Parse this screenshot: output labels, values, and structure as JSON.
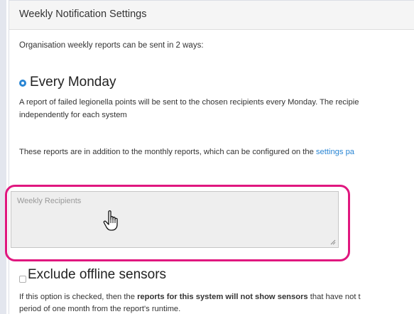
{
  "panel": {
    "title": "Weekly Notification Settings",
    "intro": "Organisation weekly reports can be sent in 2 ways:"
  },
  "monday_option": {
    "label": "Every Monday",
    "checked": true,
    "description_line1": "A report of failed legionella points will be sent to the chosen recipients every Monday. The recipie",
    "description_line2": "independently for each system"
  },
  "monthly_note": {
    "text": "These reports are in addition to the monthly reports, which can be configured on the ",
    "link_text": "settings pa"
  },
  "recipients_field": {
    "placeholder": "Weekly Recipients",
    "value": ""
  },
  "offline_option": {
    "label": "Exclude offline sensors",
    "checked": false,
    "desc_prefix": "If this option is checked, then the ",
    "desc_bold": "reports for this system will not show sensors",
    "desc_suffix": " that have not t",
    "desc_line2": "period of one month from the report's runtime."
  },
  "colors": {
    "accent": "#2a86d4",
    "highlight_border": "#e0177f",
    "header_bg": "#f5f5f5",
    "field_bg": "#eeeeee"
  },
  "icons": {
    "cursor": "hand-pointer-icon",
    "resize": "resize-grip-icon"
  }
}
